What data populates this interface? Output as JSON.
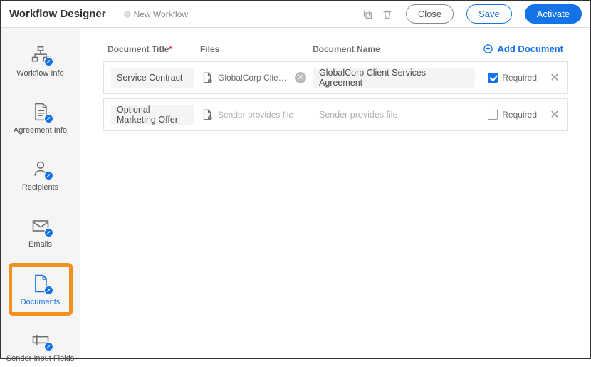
{
  "header": {
    "title": "Workflow Designer",
    "workflow_name": "New Workflow",
    "close_label": "Close",
    "save_label": "Save",
    "activate_label": "Activate"
  },
  "sidebar": {
    "items": [
      {
        "label": "Workflow Info"
      },
      {
        "label": "Agreement Info"
      },
      {
        "label": "Recipients"
      },
      {
        "label": "Emails"
      },
      {
        "label": "Documents"
      },
      {
        "label": "Sender Input Fields"
      }
    ],
    "active_index": 4
  },
  "columns": {
    "title": "Document Title",
    "files": "Files",
    "name": "Document Name"
  },
  "add_doc_label": "Add Document",
  "required_label": "Required",
  "rows": [
    {
      "title": "Service Contract",
      "file_text": "GlobalCorp Client Servic...",
      "file_placeholder": false,
      "has_clear": true,
      "name_text": "GlobalCorp Client Services Agreement",
      "name_placeholder": false,
      "required": true
    },
    {
      "title": "Optional Marketing Offer",
      "file_text": "Sender provides file",
      "file_placeholder": true,
      "has_clear": false,
      "name_text": "Sender provides file",
      "name_placeholder": true,
      "required": false
    }
  ]
}
